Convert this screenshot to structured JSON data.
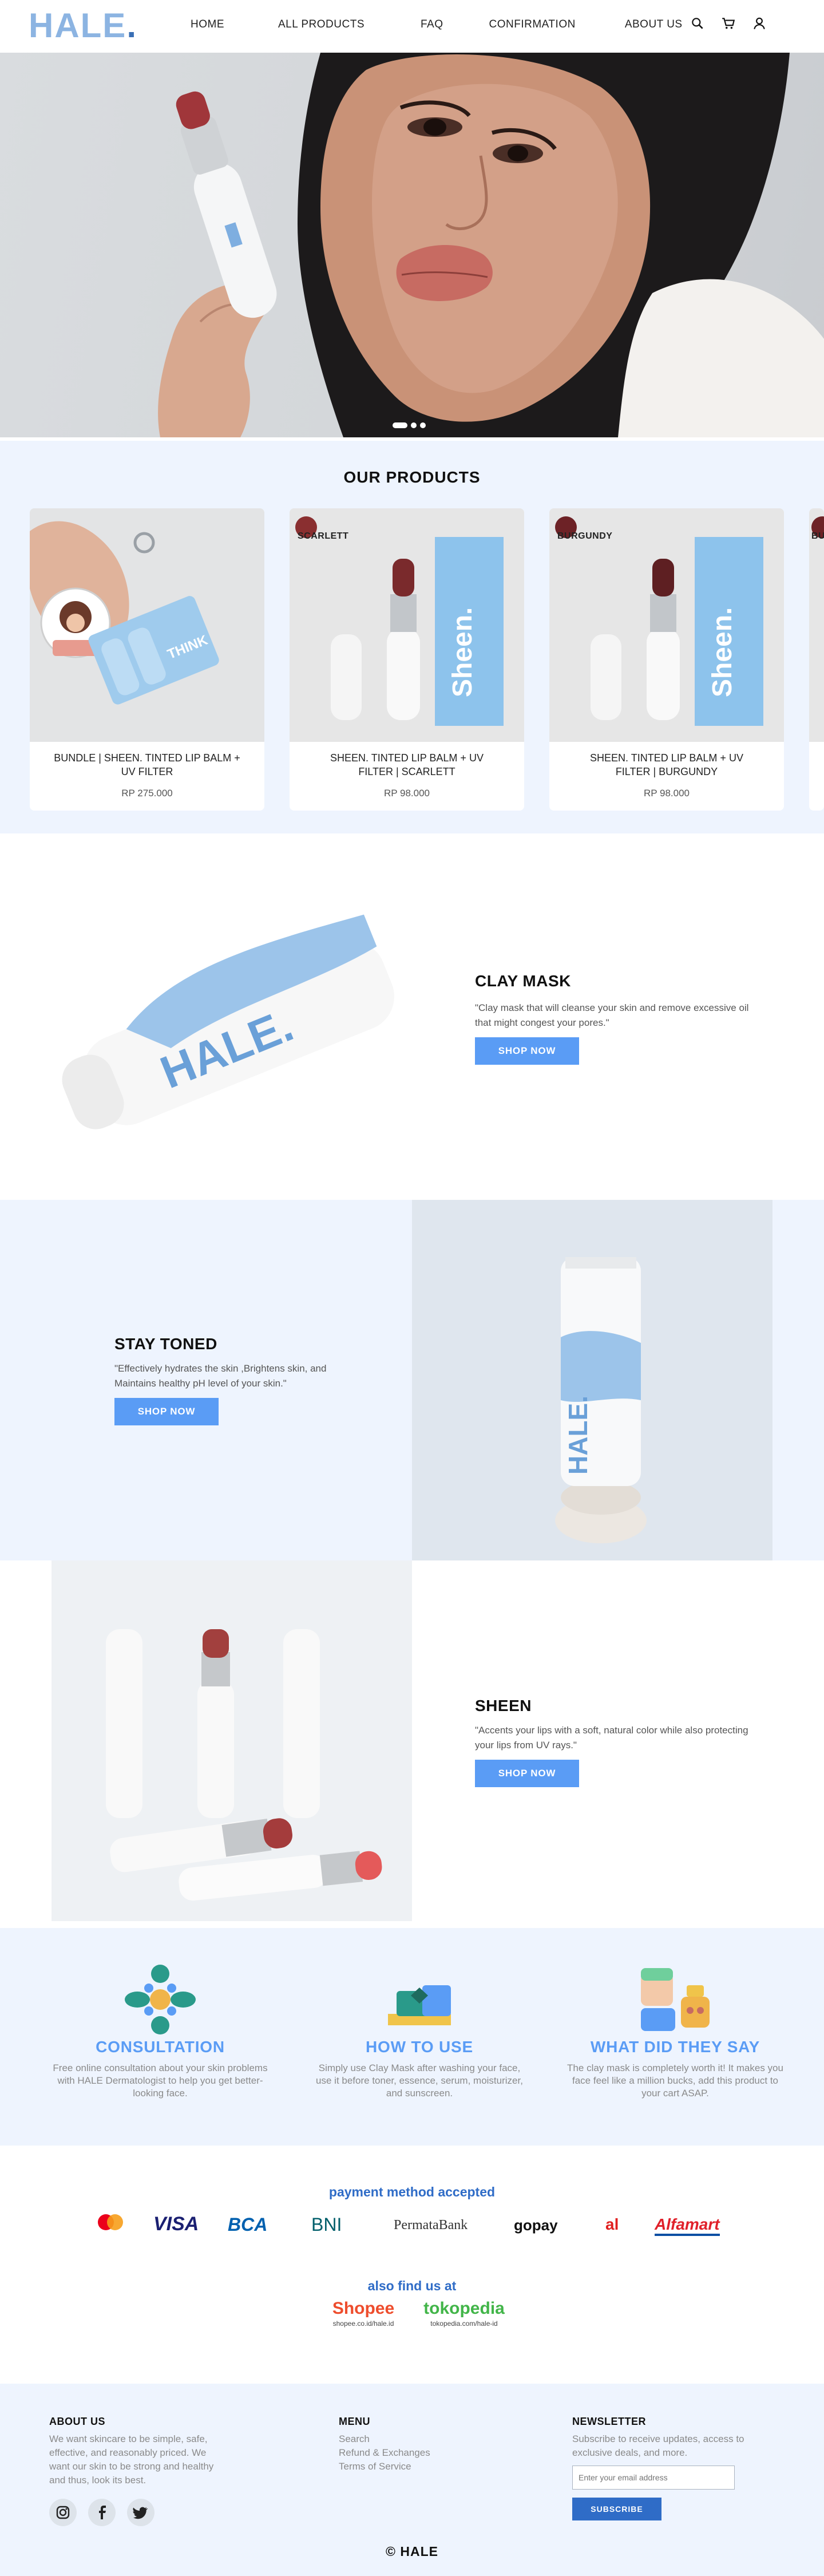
{
  "header": {
    "logo": "HALE",
    "logo_dot": ".",
    "nav": [
      "HOME",
      "ALL PRODUCTS",
      "FAQ",
      "CONFIRMATION",
      "ABOUT US"
    ]
  },
  "products": {
    "title": "OUR PRODUCTS",
    "items": [
      {
        "name": "BUNDLE | SHEEN. TINTED LIP BALM + UV  FILTER",
        "price": "RP 275.000"
      },
      {
        "name": "SHEEN. TINTED LIP BALM + UV FILTER | SCARLETT",
        "price": "RP 98.000",
        "swatch_label": "SCARLETT",
        "swatch_color": "#8a2f30"
      },
      {
        "name": "SHEEN. TINTED LIP BALM + UV FILTER | BURGUNDY",
        "price": "RP 98.000",
        "swatch_label": "BURGUNDY",
        "swatch_color": "#6d2226"
      }
    ],
    "partial_label": "BU"
  },
  "features": [
    {
      "title": "CLAY MASK",
      "text": "\"Clay mask that will cleanse your skin and remove excessive oil that might congest your pores.\"",
      "button": "SHOP NOW"
    },
    {
      "title": "STAY TONED",
      "text": "\"Effectively hydrates the skin ,Brightens skin, and Maintains healthy pH level of your skin.\"",
      "button": "SHOP NOW"
    },
    {
      "title": "SHEEN",
      "text": "\"Accents your lips with a soft, natural color while also protecting your lips from UV rays.\"",
      "button": "SHOP NOW"
    }
  ],
  "info": [
    {
      "title": "CONSULTATION",
      "text": "Free online consultation about your skin problems with HALE Dermatologist to help you get better-looking face."
    },
    {
      "title": "HOW TO USE",
      "text": "Simply use Clay Mask after washing your face, use it before toner, essence, serum, moisturizer, and sunscreen."
    },
    {
      "title": "WHAT DID THEY SAY",
      "text": "The clay mask is completely worth it! It makes you face feel like a million bucks, add this product to your cart ASAP."
    }
  ],
  "payment": {
    "title": "payment method accepted",
    "logos": [
      "VISA",
      "BCA",
      "BNI",
      "PermataBank",
      "gopay",
      "Alfamart"
    ],
    "find_title": "also find us at",
    "stores": [
      {
        "name": "Shopee",
        "url": "shopee.co.id/hale.id",
        "color": "#ee4d2d"
      },
      {
        "name": "tokopedia",
        "url": "tokopedia.com/hale-id",
        "color": "#42b549"
      }
    ]
  },
  "footer": {
    "about_title": "ABOUT US",
    "about_text": "We want skincare to be simple, safe, effective, and reasonably priced. We want our skin to be strong and healthy and thus, look its best.",
    "menu_title": "MENU",
    "menu": [
      "Search",
      "Refund & Exchanges",
      "Terms of Service"
    ],
    "news_title": "NEWSLETTER",
    "news_text": "Subscribe to receive updates, access to exclusive deals, and more.",
    "email_placeholder": "Enter your email address",
    "subscribe": "SUBSCRIBE",
    "copyright": "© HALE"
  },
  "colors": {
    "accent": "#5a9cf5",
    "brand_blue": "#8cb4e2",
    "section_bg": "#eef4fe"
  }
}
